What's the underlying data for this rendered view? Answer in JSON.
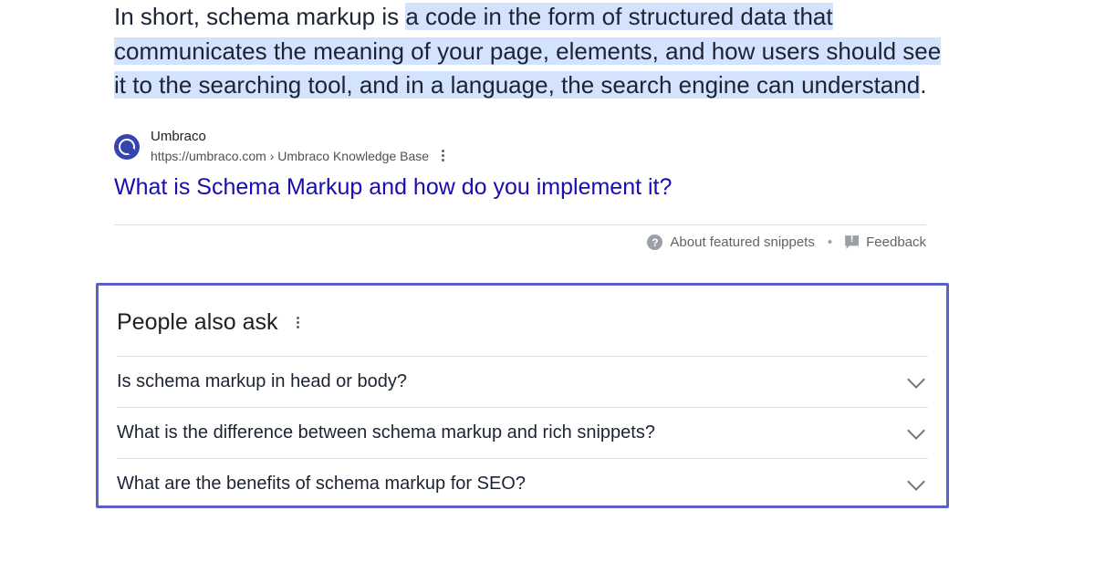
{
  "snippet": {
    "prefix": "In short, schema markup is ",
    "highlighted": "a code in the form of structured data that communicates the meaning of your page, elements, and how users should see it to the searching tool, and in a language, the search engine can understand",
    "suffix": "."
  },
  "source": {
    "name": "Umbraco",
    "url_display": "https://umbraco.com › Umbraco Knowledge Base"
  },
  "result_title": "What is Schema Markup and how do you implement it?",
  "meta": {
    "about": "About featured snippets",
    "feedback": "Feedback"
  },
  "paa": {
    "heading": "People also ask",
    "items": [
      "Is schema markup in head or body?",
      "What is the difference between schema markup and rich snippets?",
      "What are the benefits of schema markup for SEO?"
    ]
  }
}
